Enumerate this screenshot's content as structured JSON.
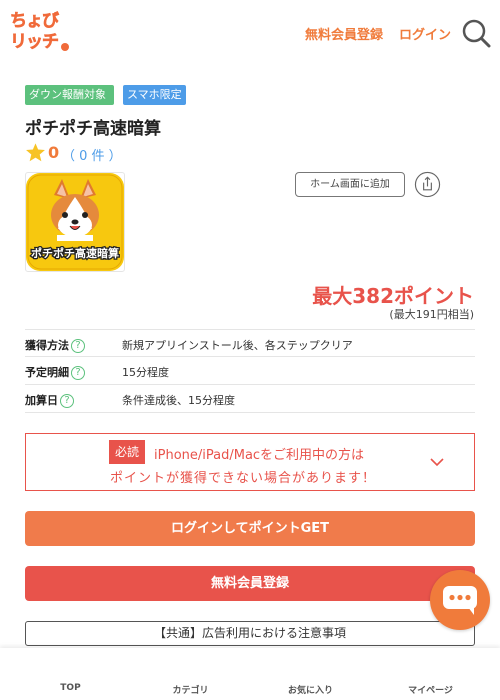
{
  "header": {
    "logo_line1": "ちょび",
    "logo_line2": "リッチ",
    "register_label": "無料会員登録",
    "login_label": "ログイン"
  },
  "badges": [
    "ダウン報酬対象",
    "スマホ限定"
  ],
  "app": {
    "title": "ポチポチ高速暗算",
    "rating_score": "0",
    "rating_count": "（ 0 件 ）",
    "icon_caption": "ポチポチ高速暗算"
  },
  "actions": {
    "home_add_label": "ホーム画面に追加"
  },
  "points": {
    "main": "最大382ポイント",
    "yen": "(最大191円相当)"
  },
  "info": [
    {
      "label": "獲得方法",
      "value": "新規アプリインストール後、各ステップクリア"
    },
    {
      "label": "予定明細",
      "value": "15分程度"
    },
    {
      "label": "加算日",
      "value": "条件達成後、15分程度"
    }
  ],
  "help_glyph": "?",
  "notice": {
    "tag": "必読",
    "line1": "iPhone/iPad/Macをご利用中の方は",
    "line2": "ポイントが獲得できない場合があります！"
  },
  "buttons": {
    "login": "ログインしてポイントGET",
    "register": "無料会員登録",
    "caution": "【共通】広告利用における注意事項"
  },
  "bottom_nav": [
    {
      "label": "TOP",
      "icon": "home-icon"
    },
    {
      "label": "カテゴリ",
      "icon": "category-icon"
    },
    {
      "label": "お気に入り",
      "icon": "heart-icon"
    },
    {
      "label": "マイページ",
      "icon": "user-icon"
    }
  ],
  "colors": {
    "brand_orange": "#f07b3b",
    "alert_red": "#e8534b",
    "badge_green": "#5cc17d",
    "badge_blue": "#4d9ce8"
  }
}
